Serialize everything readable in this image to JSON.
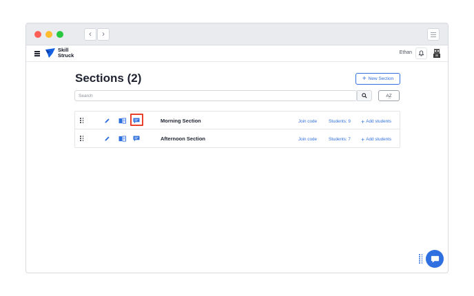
{
  "browser": {
    "back_glyph": "‹",
    "forward_glyph": "›"
  },
  "header": {
    "brand_line1": "Skill",
    "brand_line2": "Struck",
    "user_name": "Ethan"
  },
  "page": {
    "title": "Sections (2)",
    "new_section_label": "New Section",
    "search_placeholder": "Search",
    "sort_label": "A͢Z"
  },
  "sections": [
    {
      "name": "Morning Section",
      "join_code_label": "Join code",
      "students_label": "Students: 9",
      "add_students_label": "Add students"
    },
    {
      "name": "Afternoon Section",
      "join_code_label": "Join code",
      "students_label": "Students: 7",
      "add_students_label": "Add students"
    }
  ],
  "colors": {
    "accent": "#2f6fe0",
    "highlight": "#e8402a"
  }
}
